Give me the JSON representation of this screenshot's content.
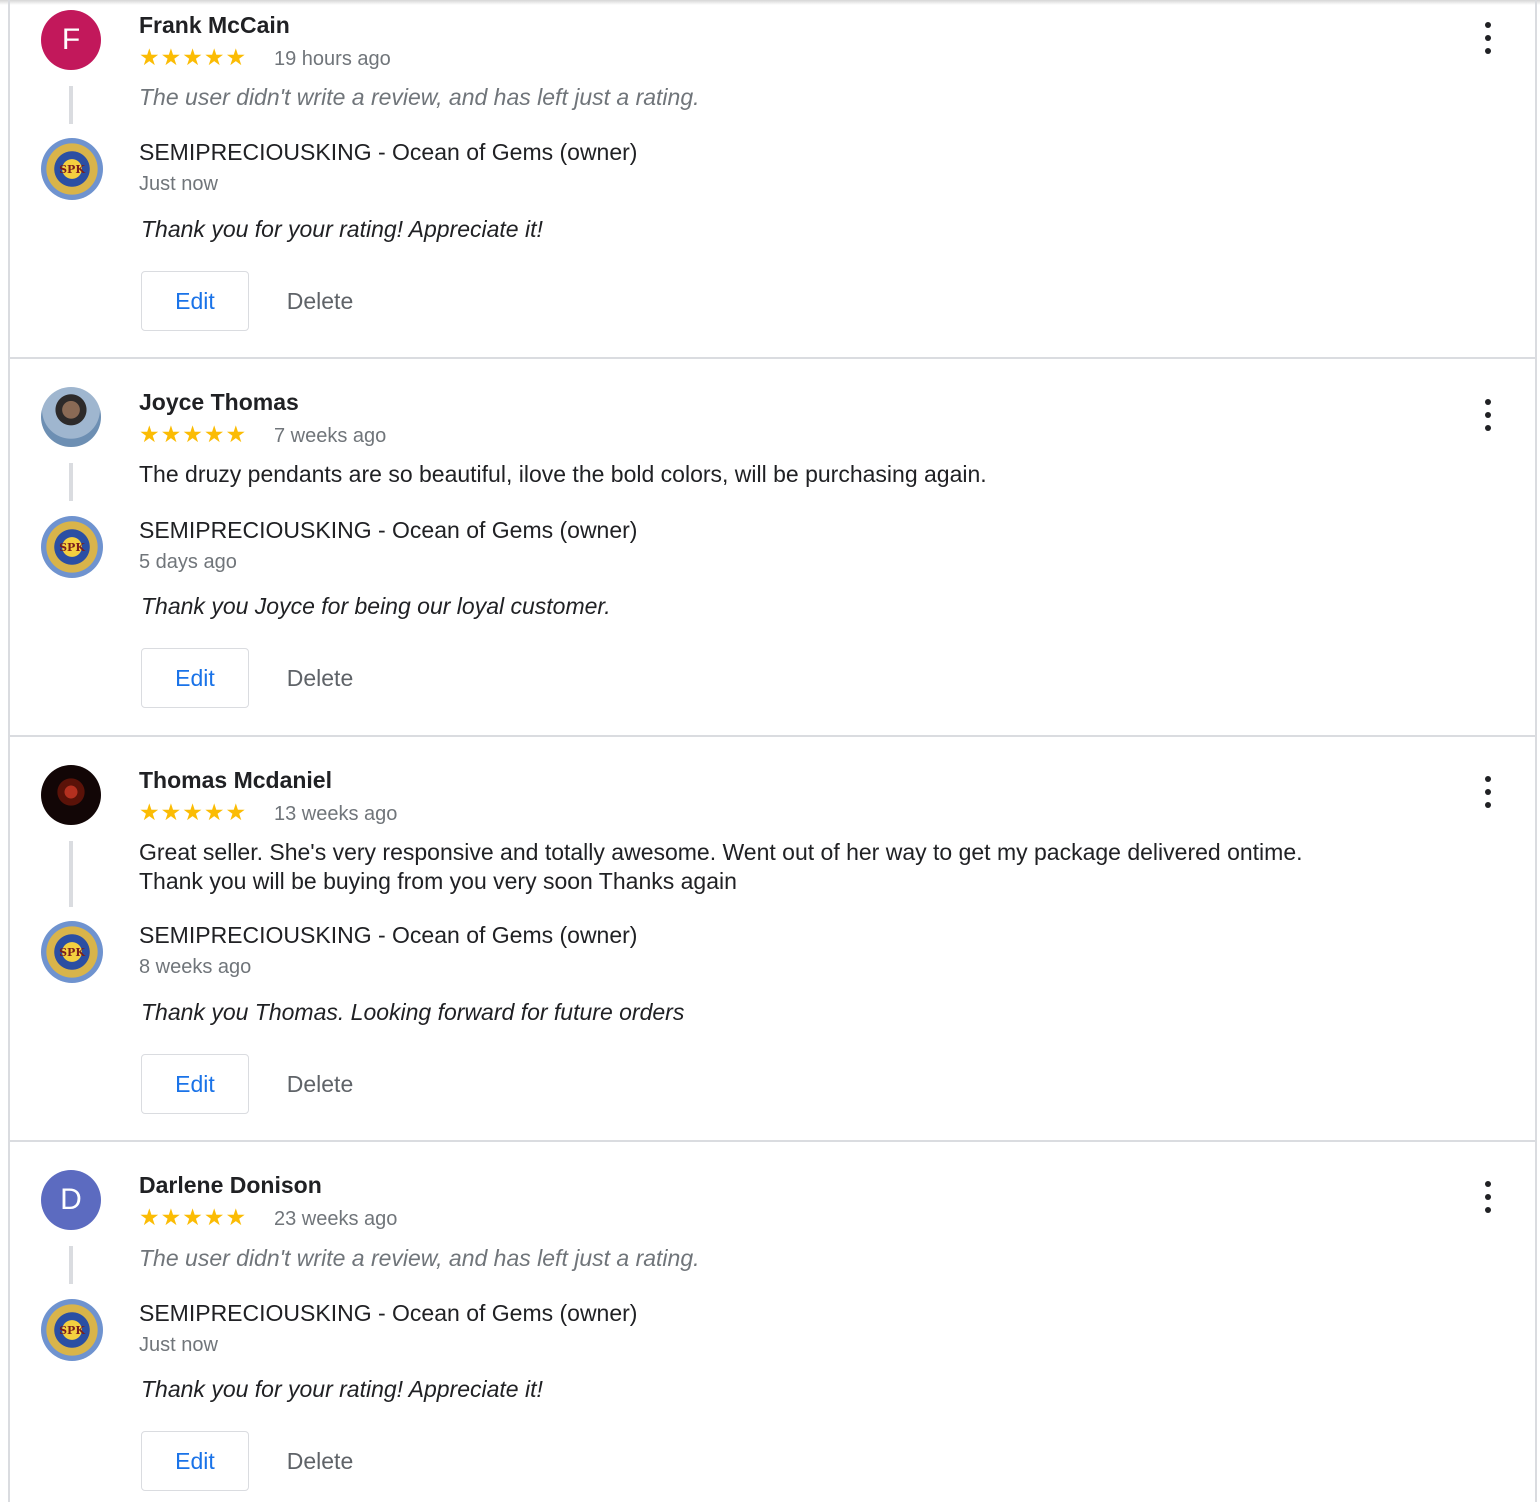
{
  "owner": {
    "name": "SEMIPRECIOUSKING - Ocean of Gems (owner)",
    "logo_text": "SPK"
  },
  "actions": {
    "edit": "Edit",
    "delete": "Delete"
  },
  "stars_glyph": "★★★★★",
  "reviews": [
    {
      "avatar_letter": "F",
      "name": "Frank McCain",
      "rating": 5,
      "time": "19 hours ago",
      "text": "The user didn't write a review, and has left just a rating.",
      "reply_time": "Just now",
      "reply": "Thank you for your rating! Appreciate it!"
    },
    {
      "avatar_letter": "",
      "name": "Joyce Thomas",
      "rating": 5,
      "time": "7 weeks ago",
      "text": "The druzy pendants are so beautiful, ilove the bold colors, will be purchasing again.",
      "reply_time": "5 days ago",
      "reply": "Thank you Joyce for being our loyal customer."
    },
    {
      "avatar_letter": "",
      "name": "Thomas Mcdaniel",
      "rating": 5,
      "time": "13 weeks ago",
      "text_line1": "Great seller. She's very responsive and totally awesome. Went out of her way to get my package delivered ontime.",
      "text_line2": "Thank you will be buying from you very soon Thanks again",
      "reply_time": "8 weeks ago",
      "reply": "Thank you Thomas. Looking forward for future orders"
    },
    {
      "avatar_letter": "D",
      "name": "Darlene Donison",
      "rating": 5,
      "time": "23 weeks ago",
      "text": "The user didn't write a review, and has left just a rating.",
      "reply_time": "Just now",
      "reply": "Thank you for your rating! Appreciate it!"
    }
  ],
  "colors": {
    "star": "#fbbc04",
    "edit_text": "#1a73e8",
    "secondary_text": "#70757a",
    "avatar_f": "#c2185b",
    "avatar_d": "#5c6bc0"
  }
}
